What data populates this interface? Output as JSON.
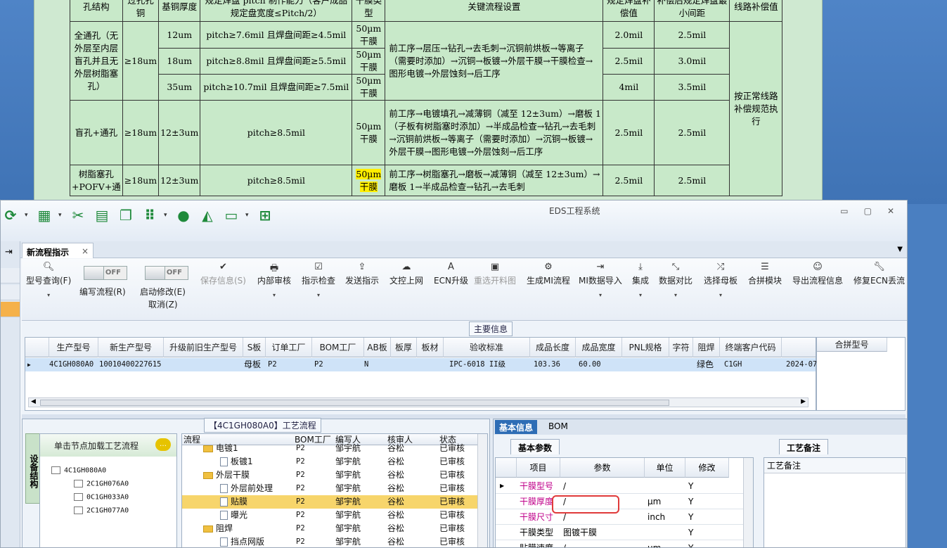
{
  "doc": {
    "header": [
      "孔结构",
      "过孔孔铜",
      "基铜厚度",
      "规定焊盘 pitch 制作能力（客户成品规定盘宽度≤Pitch/2）",
      "干膜类型",
      "关键流程设置",
      "规定焊盘补偿值",
      "补偿后规定焊盘最小间距",
      "线路补偿值"
    ],
    "group1": {
      "structure": "全通孔（无外层至内层盲孔并且无外层树脂塞孔）",
      "via_cu": "≥18um",
      "rows": [
        {
          "cu": "12um",
          "pitch": "pitch≥7.6mil 且焊盘间距≥4.5mil",
          "film": "50µm干膜",
          "comp": "2.0mil",
          "space": "2.5mil"
        },
        {
          "cu": "18um",
          "pitch": "pitch≥8.8mil 且焊盘间距≥5.5mil",
          "film": "50µm干膜",
          "comp": "2.5mil",
          "space": "3.0mil"
        },
        {
          "cu": "35um",
          "pitch": "pitch≥10.7mil 且焊盘间距≥7.5mil",
          "film": "50µm干膜",
          "comp": "4mil",
          "space": "3.5mil"
        }
      ],
      "flow": "前工序→层压→钻孔→去毛刺→沉铜前烘板→等离子（需要时添加）→沉铜→板镀→外层干膜→干膜检查→图形电镀→外层蚀刻→后工序"
    },
    "group2": {
      "structure": "盲孔+通孔",
      "via_cu": "≥18um",
      "cu": "12±3um",
      "pitch": "pitch≥8.5mil",
      "film": "50µm干膜",
      "flow": "前工序→电镀填孔→减薄铜（减至 12±3um）→磨板 1（子板有树脂塞时添加）→半成品检查→钻孔→去毛刺→沉铜前烘板→等离子（需要时添加）→沉铜→板镀→外层干膜→图形电镀→外层蚀刻→后工序",
      "comp": "2.5mil",
      "space": "2.5mil"
    },
    "group3": {
      "structure": "树脂塞孔+POFV+通",
      "via_cu": "≥18um",
      "cu": "12±3um",
      "pitch": "pitch≥8.5mil",
      "film_a": "50µm",
      "film_b": "干膜",
      "flow": "前工序→树脂塞孔→磨板→减薄铜（减至 12±3um）→磨板 1→半成品检查→钻孔→去毛刺",
      "comp": "2.5mil",
      "space": "2.5mil"
    },
    "line_comp": "按正常线路补偿规范执行"
  },
  "window": {
    "title": "EDS工程系统",
    "min": "□",
    "max": "▢",
    "close": "✕"
  },
  "qat_icons": [
    "refresh-icon",
    "table-icon",
    "scissors-icon",
    "film-icon",
    "copy-icon",
    "grid-icon",
    "user-icon",
    "chart-icon",
    "monitor-icon",
    "windows-icon"
  ],
  "tab": {
    "label": "新流程指示",
    "close": "×"
  },
  "ribbon": {
    "query": "型号查询(F)",
    "edit_flow": "编写流程(R)",
    "enable_modify": "启动修改(E)",
    "cancel": "取消(Z)",
    "toggle_off": "OFF",
    "save": "保存信息(S)",
    "inner_review": "内部审核",
    "instr_check": "指示检查",
    "send": "发送指示",
    "upload": "文控上网",
    "ecn": "ECN升级",
    "redraw": "重选开料图",
    "gen_mi": "生成MI流程",
    "mi_import": "MI数据导入",
    "integrate": "集成",
    "compare": "数据对比",
    "select_mother": "选择母板",
    "merge": "合拼模块",
    "export": "导出流程信息",
    "fix_ecn": "修复ECN丢流"
  },
  "main_info": {
    "title": "主要信息",
    "columns": [
      "生产型号",
      "新生产型号",
      "升级前旧生产型号",
      "S板",
      "订单工厂",
      "BOM工厂",
      "AB板",
      "板厚",
      "板材",
      "验收标准",
      "成品长度",
      "成品宽度",
      "PNL规格",
      "字符",
      "阻焊",
      "终端客户代码"
    ],
    "row": {
      "model": "4C1GH080A0",
      "new_model": "10010400227615",
      "s_board": "母板",
      "order_factory": "P2",
      "bom_factory": "P2",
      "ab": "N",
      "standard": "IPC-6018 II级",
      "length": "103.36",
      "width": "60.00",
      "mask": "绿色",
      "customer": "C1GH",
      "date": "2024-07"
    },
    "merge_col": "合拼型号"
  },
  "process": {
    "title": "【4C1GH080A0】工艺流程",
    "vtab": "设备结构",
    "tree_head": "单击节点加载工艺流程",
    "tree_root": "4C1GH080A0",
    "tree_children": [
      "2C1GH076A0",
      "0C1GH033A0",
      "2C1GH077A0"
    ],
    "columns": [
      "流程",
      "BOM工厂",
      "编写人",
      "核审人",
      "状态"
    ],
    "rows": [
      {
        "name": "电镀1",
        "factory": "P2",
        "writer": "邹宇航",
        "reviewer": "谷松",
        "status": "已审核"
      },
      {
        "name": "板镀1",
        "factory": "P2",
        "writer": "邹宇航",
        "reviewer": "谷松",
        "status": "已审核"
      },
      {
        "name": "外层干膜",
        "factory": "P2",
        "writer": "邹宇航",
        "reviewer": "谷松",
        "status": "已审核"
      },
      {
        "name": "外层前处理",
        "factory": "P2",
        "writer": "邹宇航",
        "reviewer": "谷松",
        "status": "已审核"
      },
      {
        "name": "贴膜",
        "factory": "P2",
        "writer": "邹宇航",
        "reviewer": "谷松",
        "status": "已审核"
      },
      {
        "name": "曝光",
        "factory": "P2",
        "writer": "邹宇航",
        "reviewer": "谷松",
        "status": "已审核"
      },
      {
        "name": "阻焊",
        "factory": "P2",
        "writer": "邹宇航",
        "reviewer": "谷松",
        "status": "已审核"
      },
      {
        "name": "挡点网版",
        "factory": "P2",
        "writer": "邹宇航",
        "reviewer": "谷松",
        "status": "已审核"
      }
    ]
  },
  "basic": {
    "tab_basic": "基本信息",
    "tab_bom": "BOM",
    "sub_params": "基本参数",
    "sub_remark": "工艺备注",
    "columns": [
      "项目",
      "参数",
      "单位",
      "修改"
    ],
    "rows": [
      {
        "item": "干膜型号",
        "param": "/",
        "unit": "",
        "mod": "Y"
      },
      {
        "item": "干膜厚度",
        "param": "/",
        "unit": "µm",
        "mod": "Y"
      },
      {
        "item": "干膜尺寸",
        "param": "/",
        "unit": "inch",
        "mod": "Y"
      },
      {
        "item": "干膜类型",
        "param": "图镀干膜",
        "unit": "",
        "mod": "Y"
      },
      {
        "item": "贴膜速度",
        "param": "/",
        "unit": "µm",
        "mod": "Y"
      }
    ],
    "remark_label": "工艺备注"
  }
}
